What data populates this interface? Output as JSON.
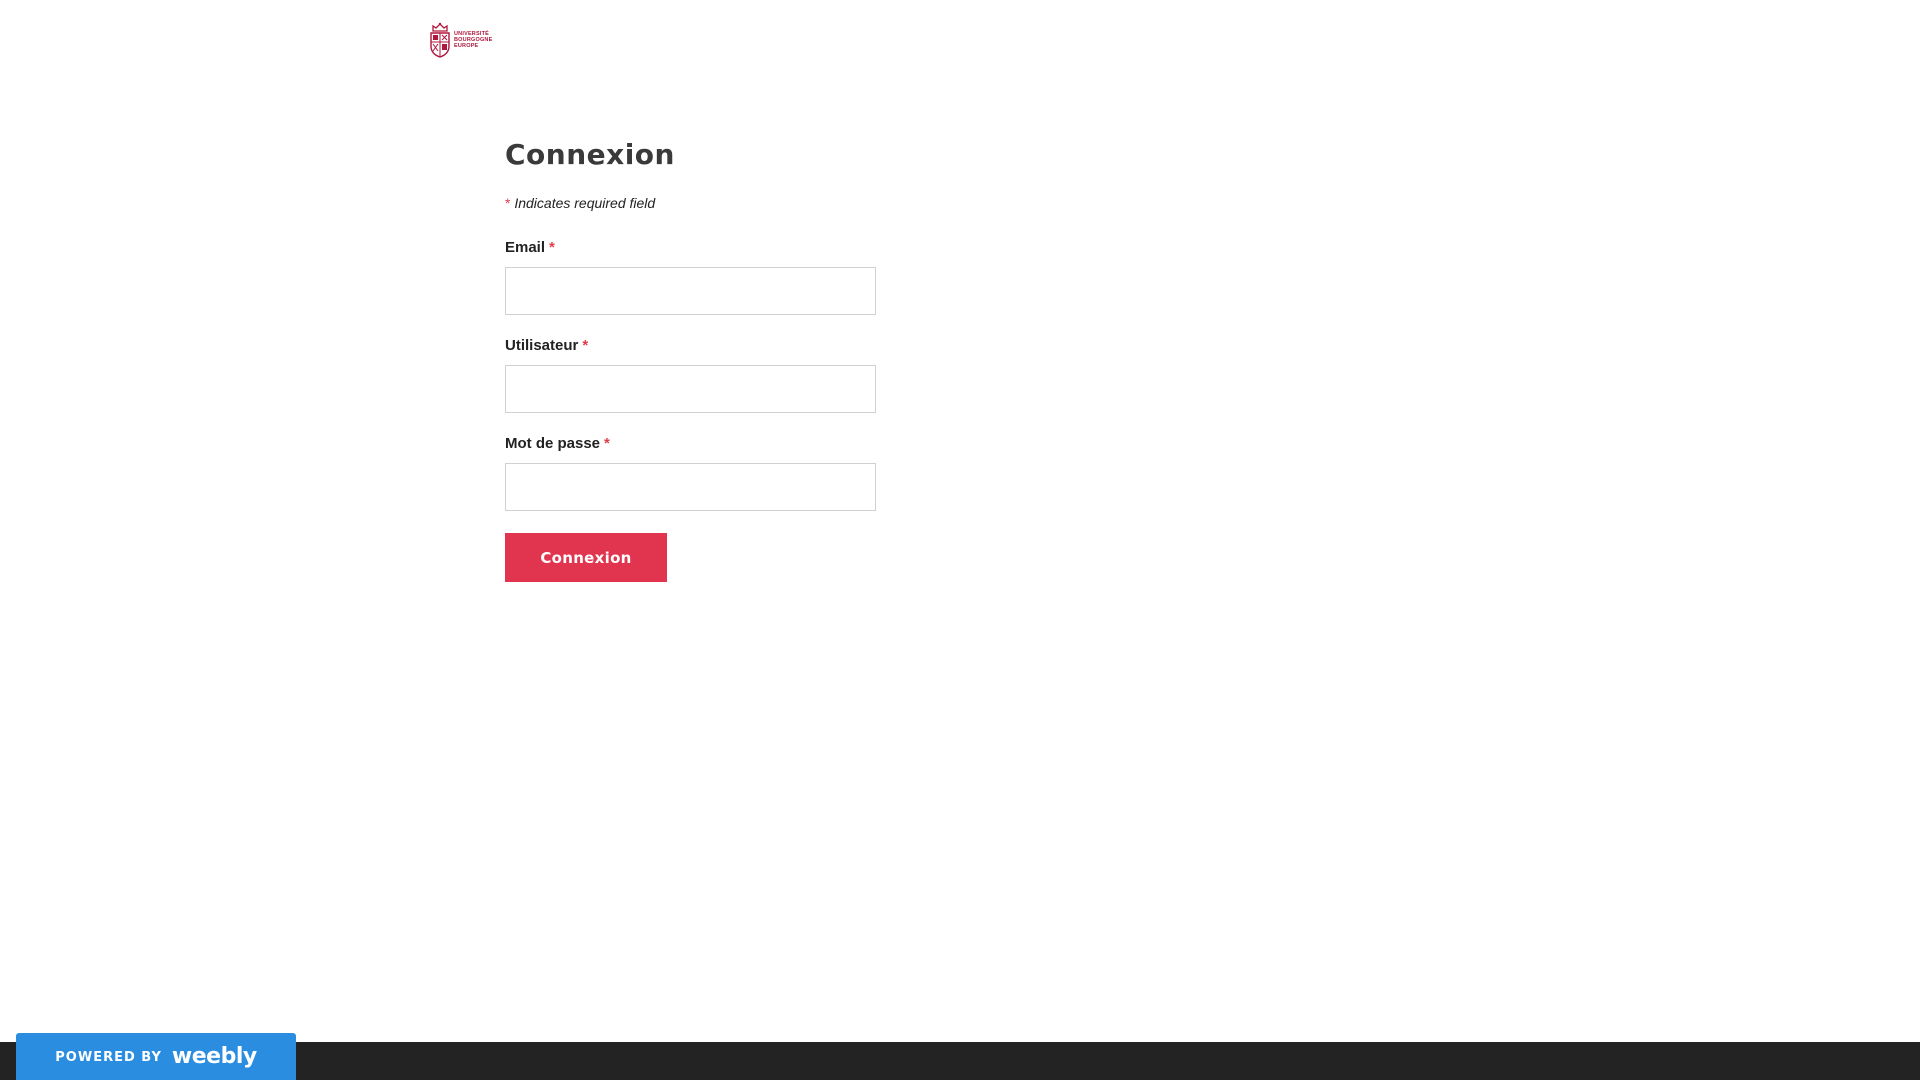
{
  "header": {
    "logo_lines": [
      "UNIVERSITÉ",
      "BOURGOGNE",
      "EUROPE"
    ],
    "logo_color": "#b0173c"
  },
  "form": {
    "title": "Connexion",
    "required_star": "*",
    "required_note": "Indicates required field",
    "fields": [
      {
        "label": "Email",
        "value": "",
        "placeholder": ""
      },
      {
        "label": "Utilisateur",
        "value": "",
        "placeholder": ""
      },
      {
        "label": "Mot de passe",
        "value": "",
        "placeholder": ""
      }
    ],
    "submit_label": "Connexion",
    "accent_color": "#e0344f"
  },
  "footer": {
    "powered_by": "POWERED BY",
    "brand": "weebly",
    "badge_color": "#2a8de0",
    "bar_color": "#232323"
  }
}
